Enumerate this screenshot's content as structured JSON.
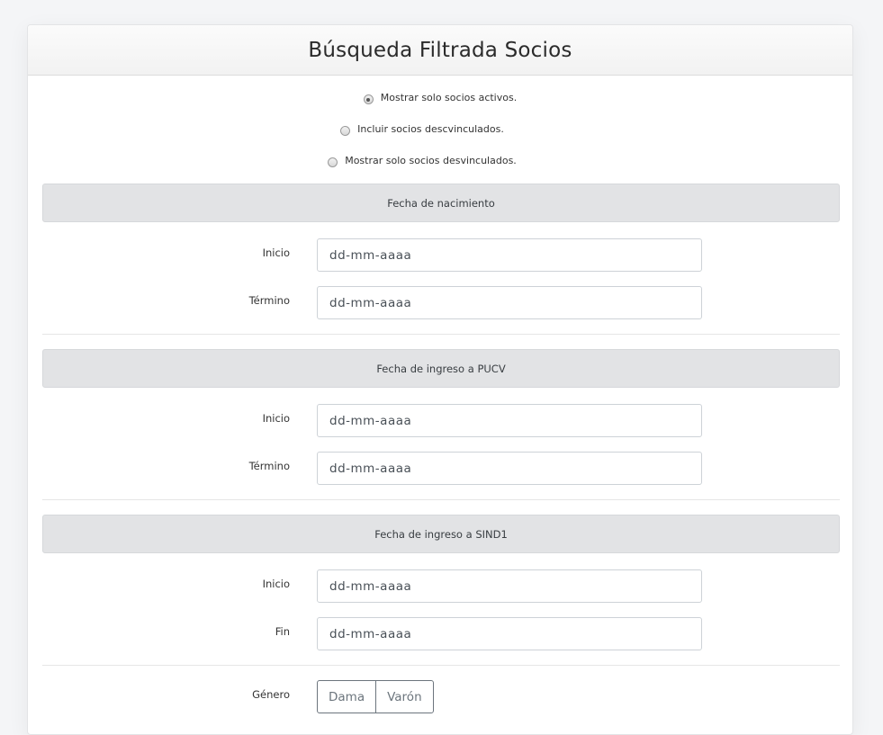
{
  "card": {
    "title": "Búsqueda Filtrada Socios"
  },
  "status_filter": {
    "options": [
      {
        "label": "Mostrar solo socios activos.",
        "checked": true
      },
      {
        "label": "Incluir socios descvinculados.",
        "checked": false
      },
      {
        "label": "Mostrar solo socios desvinculados.",
        "checked": false
      }
    ]
  },
  "sections": {
    "nacimiento": {
      "title": "Fecha de nacimiento",
      "start_label": "Inicio",
      "end_label": "Término",
      "start_placeholder": "dd-mm-aaaa",
      "end_placeholder": "dd-mm-aaaa"
    },
    "pucv": {
      "title": "Fecha de ingreso a PUCV",
      "start_label": "Inicio",
      "end_label": "Término",
      "start_placeholder": "dd-mm-aaaa",
      "end_placeholder": "dd-mm-aaaa"
    },
    "sind1": {
      "title": "Fecha de ingreso a SIND1",
      "start_label": "Inicio",
      "end_label": "Fin",
      "start_placeholder": "dd-mm-aaaa",
      "end_placeholder": "dd-mm-aaaa"
    }
  },
  "gender": {
    "label": "Género",
    "options": [
      "Dama",
      "Varón"
    ]
  }
}
